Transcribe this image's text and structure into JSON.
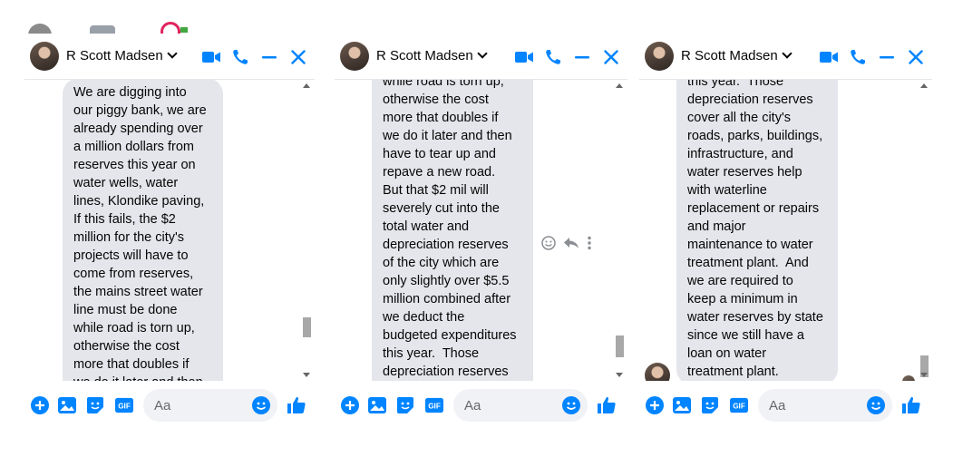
{
  "chat": {
    "contact_name": "R Scott Madsen",
    "composer_placeholder": "Aa",
    "gif_label": "GIF"
  },
  "colors": {
    "accent": "#0084ff",
    "bubble": "#e4e6eb",
    "composer_bg": "#f0f2f5"
  },
  "panels": [
    {
      "message_text": "We are digging into\nour piggy bank, we are\nalready spending over\na million dollars from\nreserves this year on\nwater wells, water\nlines, Klondike paving,\nIf this fails, the $2\nmillion for the city's\nprojects will have to\ncome from reserves,\nthe mains street water\nline must be done\nwhile road is torn up,\notherwise the cost\nmore that doubles if\nwe do it later and then\nhave to tear up and"
    },
    {
      "message_text": "while road is torn up,\notherwise the cost\nmore that doubles if\nwe do it later and then\nhave to tear up and\nrepave a new road.\nBut that $2 mil will\nseverely cut into the\ntotal water and\ndepreciation reserves\nof the city which are\nonly slightly over $5.5\nmillion combined after\nwe deduct the\nbudgeted expenditures\nthis year.  Those\ndepreciation reserves\ncover all the city's"
    },
    {
      "message_text": "this year.  Those\ndepreciation reserves\ncover all the city's\nroads, parks, buildings,\ninfrastructure, and\nwater reserves help\nwith waterline\nreplacement or repairs\nand major\nmaintenance to water\ntreatment plant.  And\nwe are required to\nkeep a minimum in\nwater reserves by state\nsince we still have a\nloan on water\ntreatment plant."
    }
  ]
}
